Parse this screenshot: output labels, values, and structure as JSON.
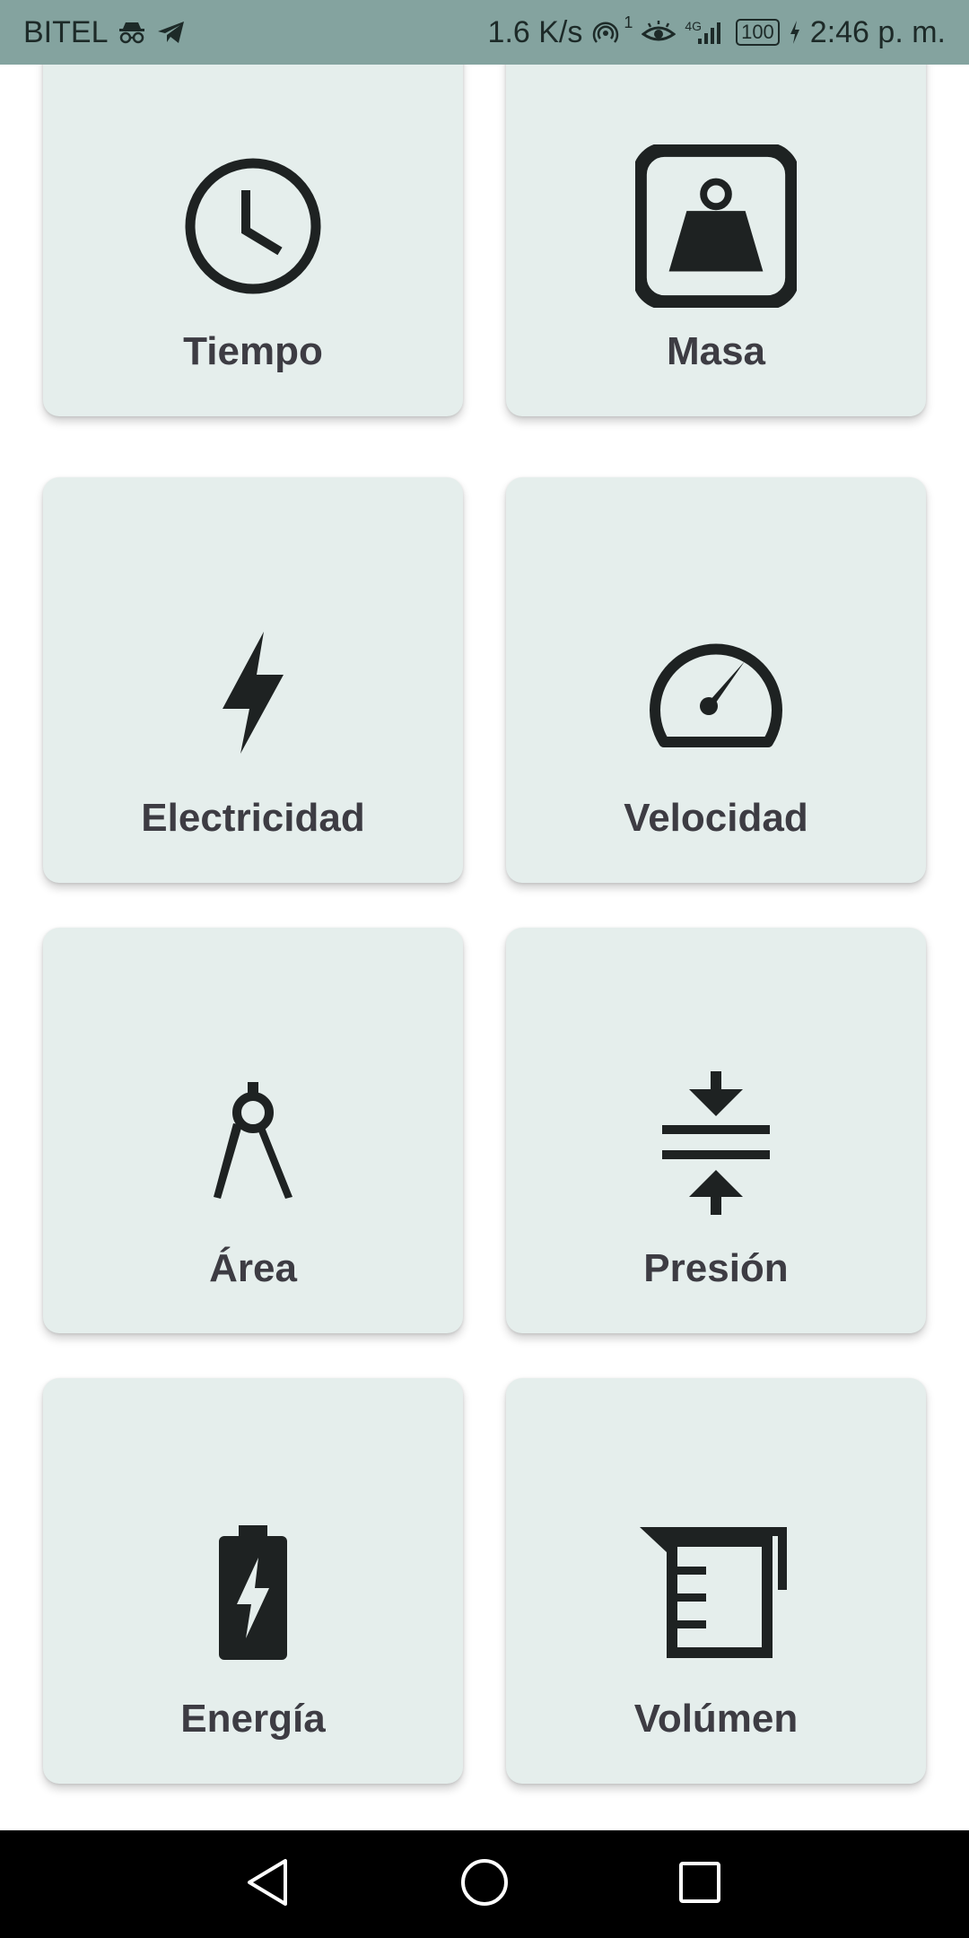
{
  "status_bar": {
    "carrier": "BITEL",
    "net_speed": "1.6 K/s",
    "hotspot_count": "1",
    "network_type": "4G",
    "battery_level": "100",
    "time": "2:46 p. m.",
    "icons": [
      "incognito-icon",
      "telegram-icon",
      "hotspot-icon",
      "eye-icon",
      "signal-icon",
      "battery-icon",
      "charging-icon"
    ]
  },
  "categories": [
    {
      "label": "Tiempo",
      "icon": "clock-icon"
    },
    {
      "label": "Masa",
      "icon": "weight-icon"
    },
    {
      "label": "Electricidad",
      "icon": "lightning-icon"
    },
    {
      "label": "Velocidad",
      "icon": "speedometer-icon"
    },
    {
      "label": "Área",
      "icon": "compass-icon"
    },
    {
      "label": "Presión",
      "icon": "compress-icon"
    },
    {
      "label": "Energía",
      "icon": "battery-charging-icon"
    },
    {
      "label": "Volúmen",
      "icon": "measuring-cup-icon"
    }
  ],
  "nav_bar": {
    "buttons": [
      "back-icon",
      "home-icon",
      "recents-icon"
    ]
  },
  "colors": {
    "status_bar_bg": "#84a39f",
    "card_bg": "#e5eeec",
    "label_text": "#3d3c43",
    "icon": "#1e2222",
    "nav_bar_bg": "#000000"
  }
}
